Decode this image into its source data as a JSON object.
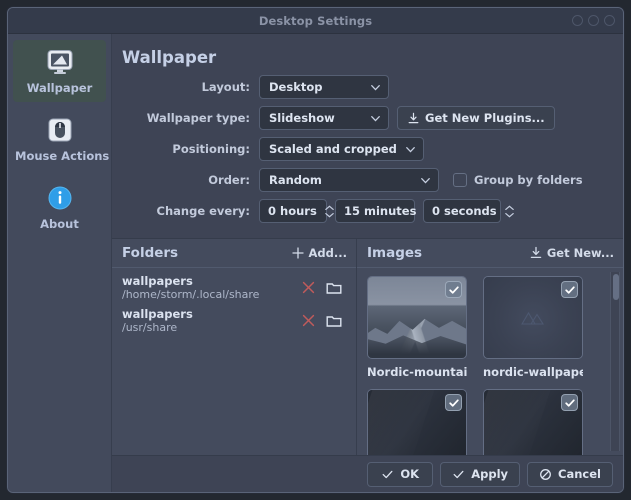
{
  "window": {
    "title": "Desktop Settings",
    "controls": [
      {
        "name": "minimize-button",
        "icon": "circle-icon"
      },
      {
        "name": "maximize-button",
        "icon": "circle-icon"
      },
      {
        "name": "close-button",
        "icon": "circle-icon"
      }
    ]
  },
  "sidebar": {
    "items": [
      {
        "label": "Wallpaper",
        "icon": "monitor-icon",
        "selected": true
      },
      {
        "label": "Mouse Actions",
        "icon": "mouse-icon",
        "selected": false
      },
      {
        "label": "About",
        "icon": "info-icon",
        "selected": false
      }
    ]
  },
  "main": {
    "page_title": "Wallpaper",
    "form": {
      "layout": {
        "label": "Layout:",
        "value": "Desktop"
      },
      "wallpaper_type": {
        "label": "Wallpaper type:",
        "value": "Slideshow"
      },
      "get_new_plugins": {
        "label": "Get New Plugins...",
        "icon": "download-icon"
      },
      "positioning": {
        "label": "Positioning:",
        "value": "Scaled and cropped"
      },
      "order": {
        "label": "Order:",
        "value": "Random"
      },
      "group_by_folders": {
        "label": "Group by folders",
        "checked": false
      },
      "change_every": {
        "label": "Change every:",
        "hours": "0 hours",
        "minutes": "15 minutes",
        "seconds": "0 seconds"
      }
    }
  },
  "folders_pane": {
    "title": "Folders",
    "add_label": "Add...",
    "add_icon": "plus-icon",
    "rows": [
      {
        "name": "wallpapers",
        "path": "/home/storm/.local/share",
        "remove_icon": "x-icon",
        "open_icon": "folder-icon"
      },
      {
        "name": "wallpapers",
        "path": "/usr/share",
        "remove_icon": "x-icon",
        "open_icon": "folder-icon"
      }
    ]
  },
  "images_pane": {
    "title": "Images",
    "get_new_label": "Get New...",
    "get_new_icon": "download-icon",
    "thumbnails": [
      {
        "label": "Nordic-mountai...",
        "checked": true,
        "style": "mountain"
      },
      {
        "label": "nordic-wallpaper",
        "checked": true,
        "style": "dark-logo"
      },
      {
        "label": "",
        "checked": true,
        "style": "dark-gradient"
      },
      {
        "label": "",
        "checked": true,
        "style": "dark-gradient"
      }
    ]
  },
  "footer": {
    "buttons": [
      {
        "label": "OK",
        "icon": "check-icon"
      },
      {
        "label": "Apply",
        "icon": "check-icon"
      },
      {
        "label": "Cancel",
        "icon": "cancel-icon"
      }
    ]
  },
  "colors": {
    "window_bg": "#3e4455",
    "titlebar_bg": "#343b4b",
    "sidebar_bg": "#434a5c",
    "panel_bg": "#444b5d",
    "selected_item": "#41514f",
    "accent_blue": "#2f9ee8",
    "remove_red": "#c05b5b",
    "text_primary": "#dde4f0",
    "text_muted": "#aeb7ca"
  }
}
